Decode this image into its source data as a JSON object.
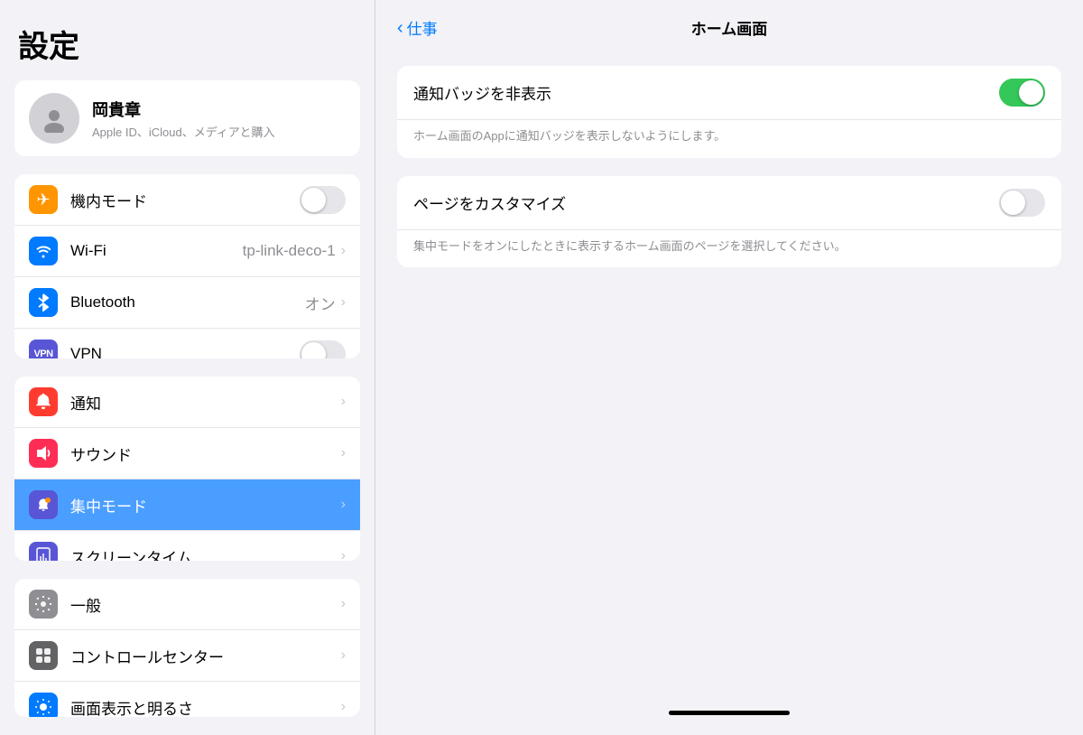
{
  "sidebar": {
    "title": "設定",
    "profile": {
      "name": "岡貴章",
      "sub": "Apple ID、iCloud、メディアと購入"
    },
    "groups": [
      {
        "items": [
          {
            "id": "airplane",
            "label": "機内モード",
            "icon": "✈",
            "iconClass": "icon-orange",
            "toggle": true,
            "toggleOn": false,
            "value": ""
          },
          {
            "id": "wifi",
            "label": "Wi-Fi",
            "icon": "wifi",
            "iconClass": "icon-blue",
            "toggle": false,
            "value": "tp-link-deco-1"
          },
          {
            "id": "bluetooth",
            "label": "Bluetooth",
            "icon": "bt",
            "iconClass": "icon-blue-dark",
            "toggle": false,
            "value": "オン"
          },
          {
            "id": "vpn",
            "label": "VPN",
            "icon": "VPN",
            "iconClass": "icon-indigo",
            "toggle": true,
            "toggleOn": false,
            "value": ""
          }
        ]
      },
      {
        "items": [
          {
            "id": "notifications",
            "label": "通知",
            "icon": "🔔",
            "iconClass": "icon-red",
            "toggle": false,
            "value": ""
          },
          {
            "id": "sounds",
            "label": "サウンド",
            "icon": "🔊",
            "iconClass": "icon-pink",
            "toggle": false,
            "value": ""
          },
          {
            "id": "focus",
            "label": "集中モード",
            "icon": "🌙",
            "iconClass": "icon-purple2",
            "toggle": false,
            "value": "",
            "active": true
          },
          {
            "id": "screentime",
            "label": "スクリーンタイム",
            "icon": "⌛",
            "iconClass": "icon-hourglass",
            "toggle": false,
            "value": ""
          }
        ]
      },
      {
        "items": [
          {
            "id": "general",
            "label": "一般",
            "icon": "⚙",
            "iconClass": "icon-gray",
            "toggle": false,
            "value": ""
          },
          {
            "id": "controlcenter",
            "label": "コントロールセンター",
            "icon": "⊞",
            "iconClass": "icon-gray2",
            "toggle": false,
            "value": ""
          },
          {
            "id": "display",
            "label": "画面表示と明るさ",
            "icon": "☀",
            "iconClass": "icon-blue",
            "toggle": false,
            "value": ""
          }
        ]
      }
    ]
  },
  "main": {
    "back_label": "仕事",
    "title": "ホーム画面",
    "sections": [
      {
        "rows": [
          {
            "id": "hide-badges",
            "label": "通知バッジを非表示",
            "toggleOn": true
          }
        ],
        "desc": "ホーム画面のAppに通知バッジを表示しないようにします。"
      },
      {
        "rows": [
          {
            "id": "customize-pages",
            "label": "ページをカスタマイズ",
            "toggleOn": false
          }
        ],
        "desc": "集中モードをオンにしたときに表示するホーム画面のページを選択してください。"
      }
    ]
  }
}
